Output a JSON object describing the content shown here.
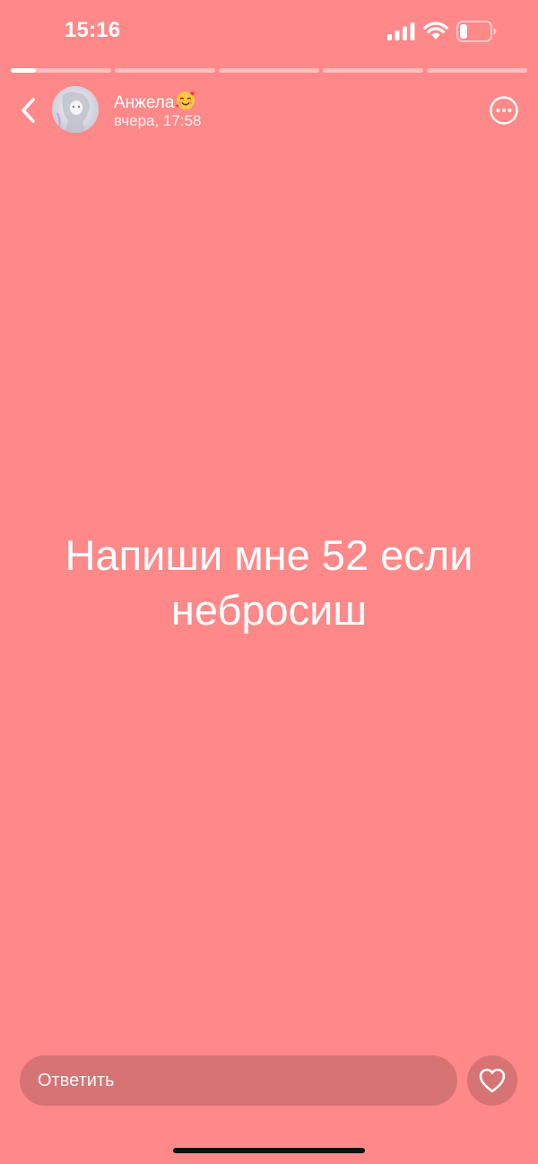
{
  "status_bar": {
    "time": "15:16",
    "battery_level": 0.25
  },
  "story": {
    "progress": [
      0.25,
      0,
      0,
      0,
      0
    ],
    "author": {
      "name": "Анжела"
    },
    "time": "вчера, 17:58",
    "text": "Напиши мне 52 если небросиш",
    "background_color": "#ff8889"
  },
  "reply": {
    "placeholder": "Ответить"
  },
  "icons": {
    "back": "chevron-left-icon",
    "more": "more-icon",
    "like": "heart-icon",
    "signal": "signal-icon",
    "wifi": "wifi-icon",
    "battery": "battery-icon",
    "emoji": "smiling-face-with-hearts-icon"
  }
}
